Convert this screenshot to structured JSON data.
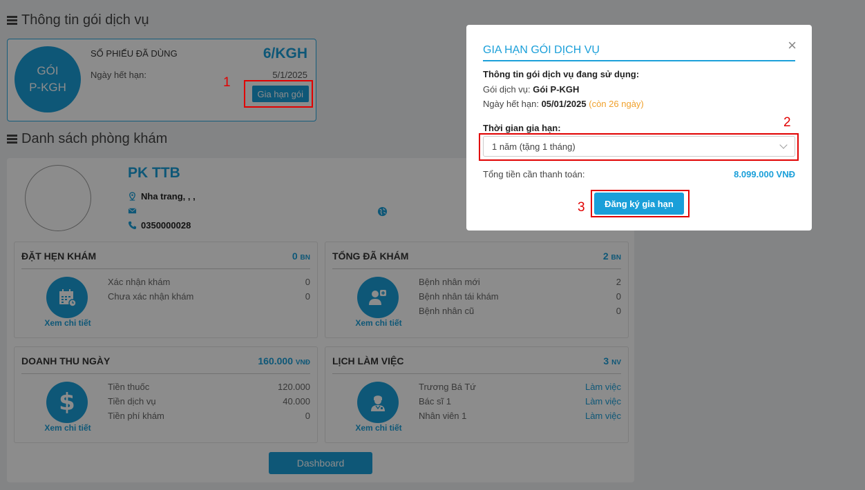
{
  "package_section": {
    "title": "Thông tin gói dịch vụ",
    "circle_line1": "GÓI",
    "circle_line2": "P-KGH",
    "used_label": "SỐ PHIẾU ĐÃ DÙNG",
    "used_value": "6/KGH",
    "expiry_label": "Ngày hết hạn:",
    "expiry_value": "5/1/2025",
    "renew_button": "Gia hạn gói"
  },
  "clinic_section": {
    "title": "Danh sách phòng khám",
    "name": "PK TTB",
    "address": "Nha trang, , ,",
    "email": "",
    "phone": "0350000028"
  },
  "stats": [
    {
      "title": "ĐẶT HẸN KHÁM",
      "total": "0",
      "unit": "BN",
      "icon": "calendar-icon",
      "link": "Xem chi tiết",
      "rows": [
        {
          "label": "Xác nhận khám",
          "value": "0"
        },
        {
          "label": "Chưa xác nhận khám",
          "value": "0"
        }
      ]
    },
    {
      "title": "TỔNG ĐÃ KHÁM",
      "total": "2",
      "unit": "BN",
      "icon": "patient-icon",
      "link": "Xem chi tiết",
      "rows": [
        {
          "label": "Bệnh nhân mới",
          "value": "2"
        },
        {
          "label": "Bệnh nhân tái khám",
          "value": "0"
        },
        {
          "label": "Bệnh nhân cũ",
          "value": "0"
        }
      ]
    },
    {
      "title": "DOANH THU NGÀY",
      "total": "160.000",
      "unit": "VNĐ",
      "icon": "dollar-icon",
      "link": "Xem chi tiết",
      "rows": [
        {
          "label": "Tiền thuốc",
          "value": "120.000"
        },
        {
          "label": "Tiền dịch vụ",
          "value": "40.000"
        },
        {
          "label": "Tiền phí khám",
          "value": "0"
        }
      ]
    },
    {
      "title": "LỊCH LÀM VIỆC",
      "total": "3",
      "unit": "NV",
      "icon": "doctor-icon",
      "link": "Xem chi tiết",
      "rows": [
        {
          "label": "Trương Bá Tứ",
          "value": "Làm việc"
        },
        {
          "label": "Bác sĩ 1",
          "value": "Làm việc"
        },
        {
          "label": "Nhân viên 1",
          "value": "Làm việc"
        }
      ]
    }
  ],
  "dashboard_button": "Dashboard",
  "modal": {
    "title": "GIA HẠN GÓI DỊCH VỤ",
    "close": "×",
    "info_heading": "Thông tin gói dịch vụ đang sử dụng:",
    "package_label": "Gói dịch vụ: ",
    "package_value": "Gói P-KGH",
    "expiry_label": "Ngày hết hạn: ",
    "expiry_value": "05/01/2025",
    "expiry_remaining": "(còn 26 ngày)",
    "period_label": "Thời gian gia hạn:",
    "period_selected": "1 năm (tặng 1 tháng)",
    "total_label": "Tổng tiền cần thanh toán:",
    "total_value": "8.099.000 VNĐ",
    "register_button": "Đăng ký gia hạn"
  },
  "annotations": {
    "step1": "1",
    "step2": "2",
    "step3": "3",
    "color": "#e10000"
  },
  "colors": {
    "accent": "#1a9fd9",
    "warning": "#f0a02a"
  }
}
